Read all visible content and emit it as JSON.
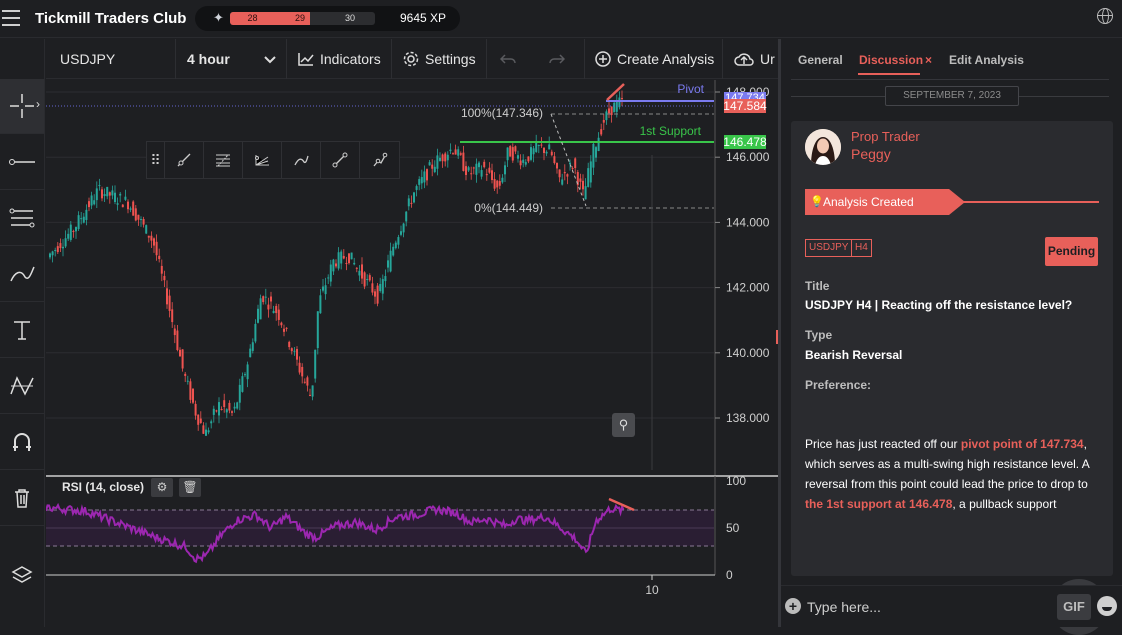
{
  "app": {
    "title": "Tickmill Traders Club",
    "xp": {
      "segment_a": "28",
      "segment_b": "29",
      "level_next": "30",
      "total": "9645 XP",
      "progress": 0.55
    }
  },
  "toolbar": {
    "symbol": "USDJPY",
    "timeframe": "4 hour",
    "indicators_label": "Indicators",
    "settings_label": "Settings",
    "create_analysis_label": "Create Analysis",
    "upload_label": "Ur"
  },
  "chart": {
    "price_axis": [
      "148.000",
      "146.000",
      "144.000",
      "142.000",
      "140.000",
      "138.000"
    ],
    "price_tags": {
      "top": "147.734",
      "current": "147.584",
      "support": "146.478"
    },
    "annotations": {
      "pivot": "Pivot",
      "support": "1st Support",
      "fib_top": "100%(147.346)",
      "fib_bottom": "0%(144.449)"
    },
    "time_axis": [
      "10"
    ],
    "rsi": {
      "label": "RSI (14, close)",
      "axis": [
        "100",
        "50",
        "0"
      ]
    }
  },
  "panel": {
    "tabs": [
      "General",
      "Discussion",
      "Edit Analysis"
    ],
    "active_tab": "Discussion",
    "date_divider": "SEPTEMBER 7, 2023",
    "author": {
      "role": "Prop Trader",
      "name": "Peggy"
    },
    "status": "Analysis Created",
    "tags": [
      "USDJPY",
      "H4"
    ],
    "state": "Pending",
    "title_label": "Title",
    "title_value": "USDJPY H4 | Reacting off the resistance level?",
    "type_label": "Type",
    "type_value": "Bearish Reversal",
    "preference_label": "Preference:",
    "body": {
      "p1": "Price has just reacted off our ",
      "hl1": "pivot point of 147.734",
      "p2": ", which serves as a multi-swing high resistance level. A reversal from this point could lead the price to drop to ",
      "hl2": "the 1st support at 146.478",
      "p3": ", a pullback support"
    },
    "composer": {
      "placeholder": "Type here...",
      "gif_label": "GIF"
    }
  },
  "colors": {
    "accent": "#e8605a",
    "up": "#26a69a",
    "down": "#ef5350",
    "pivot": "#7b7bf0",
    "support": "#39c54a",
    "rsi": "#9c27b0"
  }
}
